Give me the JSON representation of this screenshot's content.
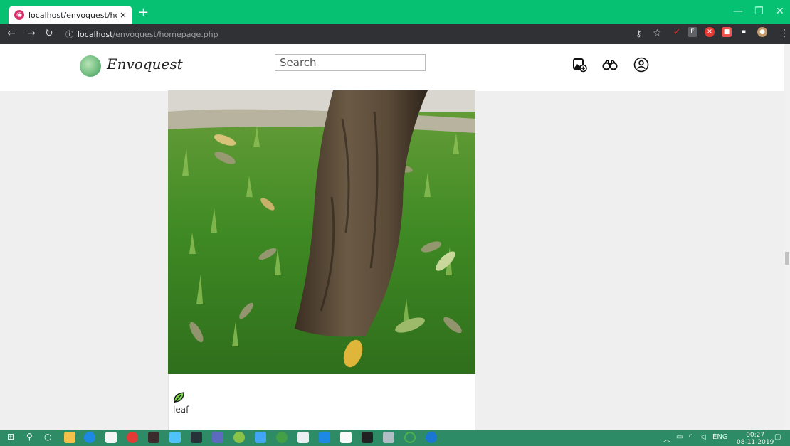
{
  "browser": {
    "tab_title": "localhost/envoquest/homepage.p",
    "tab_close": "×",
    "new_tab": "+",
    "url_host": "localhost",
    "url_path": "/envoquest/homepage.php"
  },
  "site": {
    "brand": "Envoquest",
    "search_placeholder": "Search",
    "icons": [
      "add-photo-icon",
      "binoculars-icon",
      "user-account-icon"
    ]
  },
  "post": {
    "image_icon": "tree-photo",
    "category_icon": "leaf-icon",
    "category_label": "leaf"
  },
  "taskbar": {
    "language": "ENG",
    "time": "00:27",
    "date": "08-11-2019"
  },
  "colors": {
    "tab_bar": "#07c172",
    "address_bar": "#303134",
    "taskbar": "#2d8c66",
    "page_bg": "#efefef"
  }
}
